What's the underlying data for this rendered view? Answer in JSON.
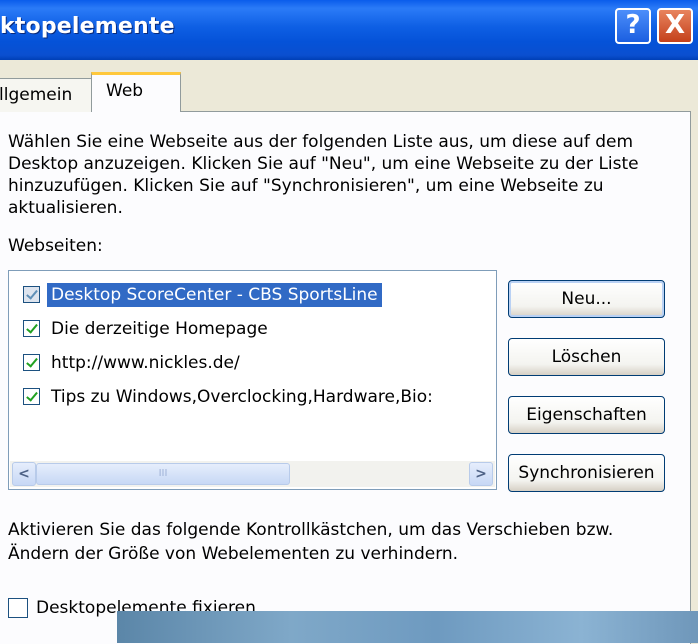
{
  "window": {
    "title": "ktopelemente",
    "help_label": "?",
    "close_label": "X"
  },
  "tabs": [
    {
      "label": "llgemein"
    },
    {
      "label": "Web"
    }
  ],
  "web": {
    "description": "Wählen Sie eine Webseite aus der folgenden Liste aus, um diese auf dem Desktop anzuzeigen. Klicken Sie auf \"Neu\", um eine Webseite zu der Liste hinzuzufügen. Klicken Sie auf \"Synchronisieren\", um eine Webseite zu aktualisieren.",
    "list_label": "Webseiten:",
    "items": [
      {
        "label": "Desktop ScoreCenter - CBS SportsLine",
        "checked": true,
        "selected": true
      },
      {
        "label": "Die derzeitige Homepage",
        "checked": true
      },
      {
        "label": "http://www.nickles.de/",
        "checked": true
      },
      {
        "label": "Tips zu Windows,Overclocking,Hardware,Bio:",
        "checked": true
      }
    ],
    "scrollbar": {
      "left_arrow": "<",
      "right_arrow": ">",
      "grip": "III"
    },
    "buttons": {
      "new": "Neu...",
      "delete": "Löschen",
      "properties": "Eigenschaften",
      "sync": "Synchronisieren"
    },
    "lock_description": "Aktivieren Sie das folgende Kontrollkästchen, um das Verschieben bzw. Ändern der Größe von Webelementen zu verhindern.",
    "lock_checkbox_label": "Desktopelemente fixieren"
  },
  "colors": {
    "titlebar": "#0A5CEB",
    "selection": "#316AC5",
    "check": "#21A121",
    "tab_highlight": "#FFC83C"
  }
}
